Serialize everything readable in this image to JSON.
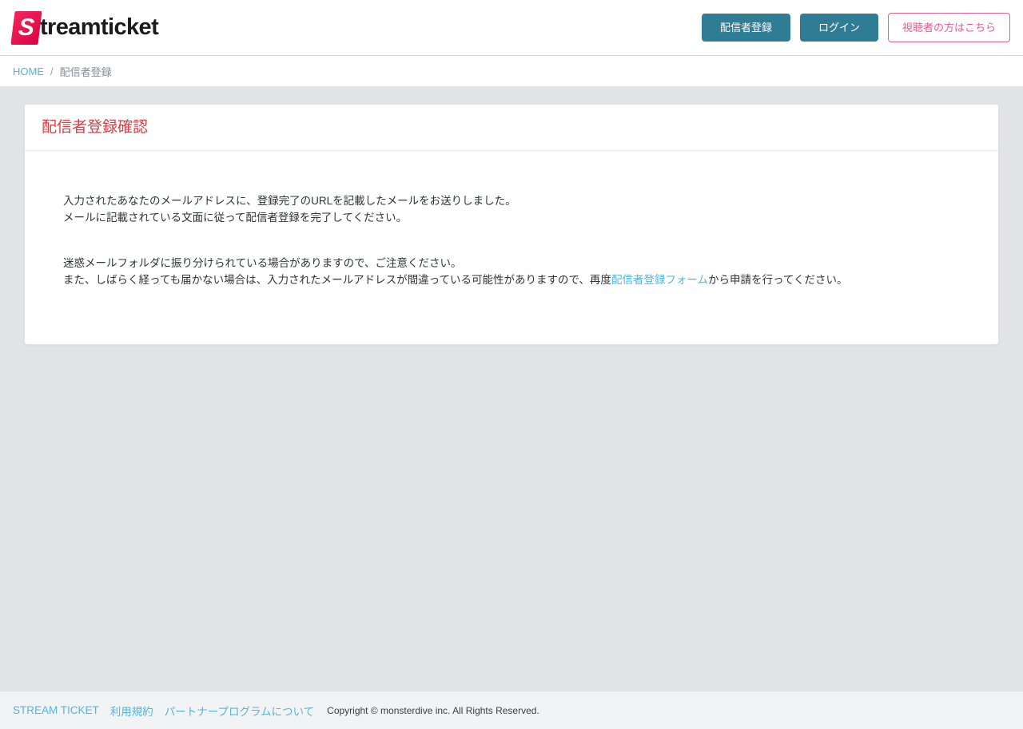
{
  "header": {
    "logo": {
      "badge_letter": "S",
      "brand_text": "treamticket",
      "badge_color": "#e8144f"
    },
    "buttons": {
      "register_broadcaster": "配信者登録",
      "login": "ログイン",
      "viewer_here": "視聴者の方はこちら"
    },
    "colors": {
      "teal": "#2e7d95",
      "pink": "#f5588c"
    }
  },
  "breadcrumb": {
    "home": "HOME",
    "separator": "/",
    "current": "配信者登録"
  },
  "card": {
    "title": "配信者登録確認",
    "title_color": "#e03c43",
    "paragraph1_line1": "入力されたあなたのメールアドレスに、登録完了のURLを記載したメールをお送りしました。",
    "paragraph1_line2": "メールに記載されている文面に従って配信者登録を完了してください。",
    "paragraph2_line1": "迷惑メールフォルダに振り分けられている場合がありますので、ご注意ください。",
    "paragraph2_line2_before": "また、しばらく経っても届かない場合は、入力されたメールアドレスが間違っている可能性がありますので、再度",
    "paragraph2_link": "配信者登録フォーム",
    "paragraph2_line2_after": "から申請を行ってください。",
    "link_color": "#51b5e0"
  },
  "footer": {
    "links": [
      {
        "label": "STREAM TICKET"
      },
      {
        "label": "利用規約"
      },
      {
        "label": "パートナープログラムについて"
      }
    ],
    "copyright": "Copyright © monsterdive inc. All Rights Reserved."
  }
}
